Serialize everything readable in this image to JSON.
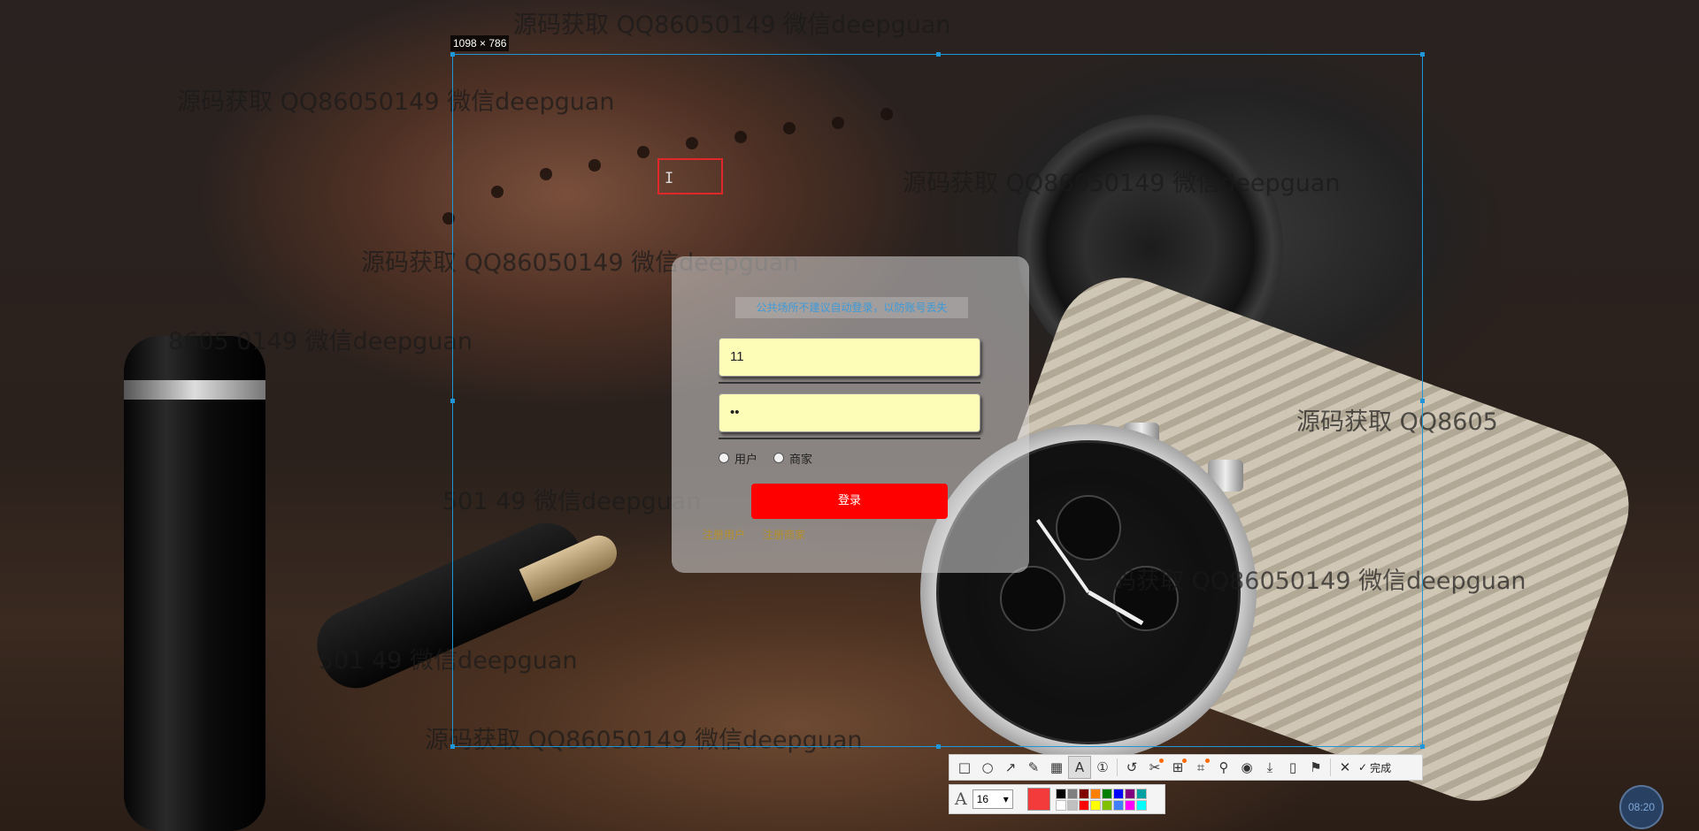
{
  "watermarks": [
    "源码获取 QQ86050149 微信deepguan",
    "源码获取 QQ86050149 微信deepguan",
    "源码获取 QQ86050149 微信deepguan",
    "源码获取 QQ86050149 微信deepguan",
    "8605 0149 微信deepguan",
    "源码获取 QQ8605",
    "501 49 微信deepguan",
    "源码获取 QQ86050149 微信deepguan",
    "501 49 微信deepguan",
    "源码获取 QQ86050149 微信deepguan"
  ],
  "capture": {
    "size_label": "1098 × 786",
    "accent_color": "#1f96d8",
    "text_box_color": "#e0282a"
  },
  "login": {
    "notice": "公共场所不建议自动登录，以防账号丢失",
    "username_value": "11",
    "password_value": "••",
    "role_options": [
      "用户",
      "商家"
    ],
    "login_button": "登录",
    "links": [
      "注册用户",
      "注册商家"
    ],
    "button_color": "#ff0000",
    "field_color": "#fdfdb8"
  },
  "toolbar": {
    "tools": [
      "rectangle-icon",
      "ellipse-icon",
      "arrow-icon",
      "pencil-icon",
      "mosaic-icon",
      "text-icon",
      "serial-number-icon",
      "undo-icon",
      "scissors-icon",
      "ocr-icon",
      "crop-icon",
      "pin-icon",
      "record-icon",
      "save-icon",
      "phone-icon",
      "bookmark-icon",
      "close-icon",
      "check-icon"
    ],
    "done_label": "完成",
    "font_size": "16",
    "current_color": "#f43b3b",
    "palette": [
      "#000000",
      "#808080",
      "#800000",
      "#ff8000",
      "#008000",
      "#0000ff",
      "#800080",
      "#00a0a0",
      "#ffffff",
      "#c0c0c0",
      "#ff0000",
      "#ffff00",
      "#80c000",
      "#4080ff",
      "#ff00ff",
      "#00ffff"
    ]
  },
  "clock": {
    "time": "08:20"
  }
}
